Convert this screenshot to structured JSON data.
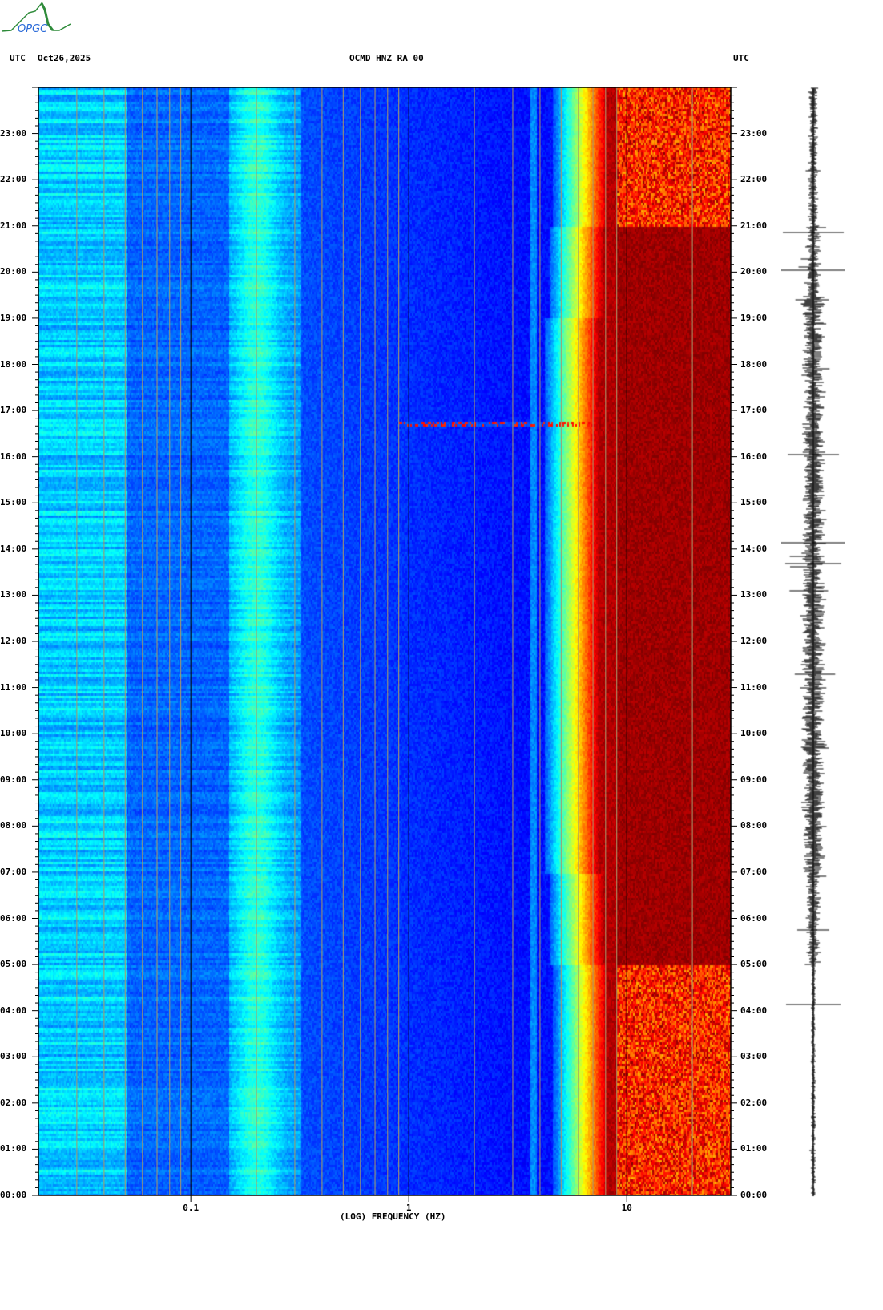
{
  "header": {
    "tz_left": "UTC",
    "date": "Oct26,2025",
    "station": "OCMD HNZ RA 00",
    "tz_right": "UTC"
  },
  "logo": {
    "text": "OPGC"
  },
  "colors": {
    "gridline_minor": "#a8976a",
    "gridline_major": "#000000",
    "trace": "#000000"
  },
  "chart_data": {
    "type": "heatmap",
    "title": "OCMD HNZ RA 00",
    "xlabel": "(LOG) FREQUENCY (HZ)",
    "xscale": "log",
    "xlim": [
      0.02,
      30
    ],
    "xticks": [
      {
        "value": 0.1,
        "label": "0.1"
      },
      {
        "value": 1,
        "label": "1"
      },
      {
        "value": 10,
        "label": "10"
      }
    ],
    "ylabel": "UTC",
    "ylim": [
      0,
      24
    ],
    "yticks": [
      {
        "value": 0,
        "label": "00:00"
      },
      {
        "value": 1,
        "label": "01:00"
      },
      {
        "value": 2,
        "label": "02:00"
      },
      {
        "value": 3,
        "label": "03:00"
      },
      {
        "value": 4,
        "label": "04:00"
      },
      {
        "value": 5,
        "label": "05:00"
      },
      {
        "value": 6,
        "label": "06:00"
      },
      {
        "value": 7,
        "label": "07:00"
      },
      {
        "value": 8,
        "label": "08:00"
      },
      {
        "value": 9,
        "label": "09:00"
      },
      {
        "value": 10,
        "label": "10:00"
      },
      {
        "value": 11,
        "label": "11:00"
      },
      {
        "value": 12,
        "label": "12:00"
      },
      {
        "value": 13,
        "label": "13:00"
      },
      {
        "value": 14,
        "label": "14:00"
      },
      {
        "value": 15,
        "label": "15:00"
      },
      {
        "value": 16,
        "label": "16:00"
      },
      {
        "value": 17,
        "label": "17:00"
      },
      {
        "value": 18,
        "label": "18:00"
      },
      {
        "value": 19,
        "label": "19:00"
      },
      {
        "value": 20,
        "label": "20:00"
      },
      {
        "value": 21,
        "label": "21:00"
      },
      {
        "value": 22,
        "label": "22:00"
      },
      {
        "value": 23,
        "label": "23:00"
      }
    ],
    "colormap": "jet",
    "features": [
      {
        "label": "persistent spectral line",
        "frequency_hz": 3.7
      },
      {
        "label": "transient event",
        "time_h": 16.75,
        "frequency_range_hz": [
          0.9,
          7
        ]
      }
    ],
    "grid": true
  }
}
